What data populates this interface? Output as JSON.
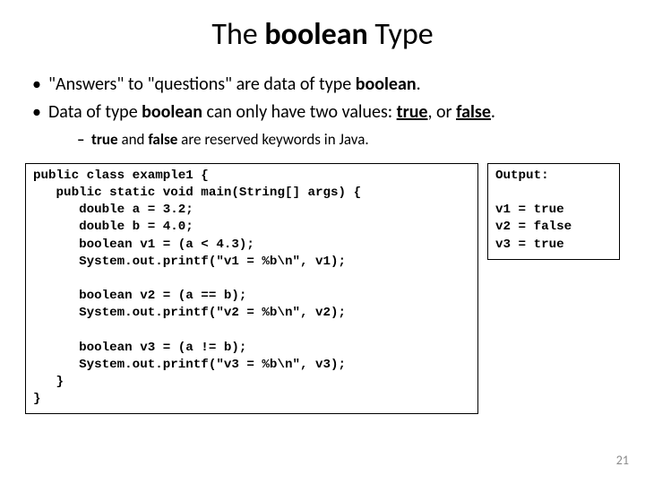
{
  "title": {
    "pre": "The ",
    "bold": "boolean",
    "post": " Type"
  },
  "bullets": [
    {
      "segments": [
        {
          "t": "\"Answers\" to \"questions\" are data of type "
        },
        {
          "t": "boolean",
          "bold": true
        },
        {
          "t": "."
        }
      ]
    },
    {
      "segments": [
        {
          "t": "Data of type "
        },
        {
          "t": "boolean",
          "bold": true
        },
        {
          "t": " can only have two values: "
        },
        {
          "t": "true",
          "bold": true,
          "u": true
        },
        {
          "t": ", or "
        },
        {
          "t": "false",
          "bold": true,
          "u": true
        },
        {
          "t": "."
        }
      ],
      "sub": [
        {
          "segments": [
            {
              "t": "true",
              "bold": true
            },
            {
              "t": " and "
            },
            {
              "t": "false",
              "bold": true
            },
            {
              "t": " are reserved keywords in Java."
            }
          ]
        }
      ]
    }
  ],
  "code": "public class example1 {\n   public static void main(String[] args) {\n      double a = 3.2;\n      double b = 4.0;\n      boolean v1 = (a < 4.3);\n      System.out.printf(\"v1 = %b\\n\", v1);\n\n      boolean v2 = (a == b);\n      System.out.printf(\"v2 = %b\\n\", v2);\n\n      boolean v3 = (a != b);\n      System.out.printf(\"v3 = %b\\n\", v3);\n   }\n}",
  "output": "Output:\n\nv1 = true\nv2 = false\nv3 = true",
  "slide_number": "21"
}
